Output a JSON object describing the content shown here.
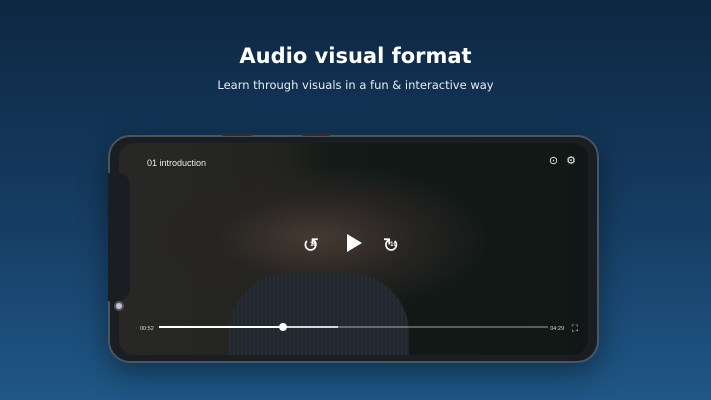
{
  "header": {
    "title": "Audio visual format",
    "subtitle": "Learn through visuals in a fun & interactive way"
  },
  "player": {
    "video_title": "01 introduction",
    "current_time": "00:52",
    "total_time": "04:29",
    "progress": 0.32,
    "buffered": 0.46,
    "skip_back_seconds": "10",
    "skip_forward_seconds": "10"
  }
}
